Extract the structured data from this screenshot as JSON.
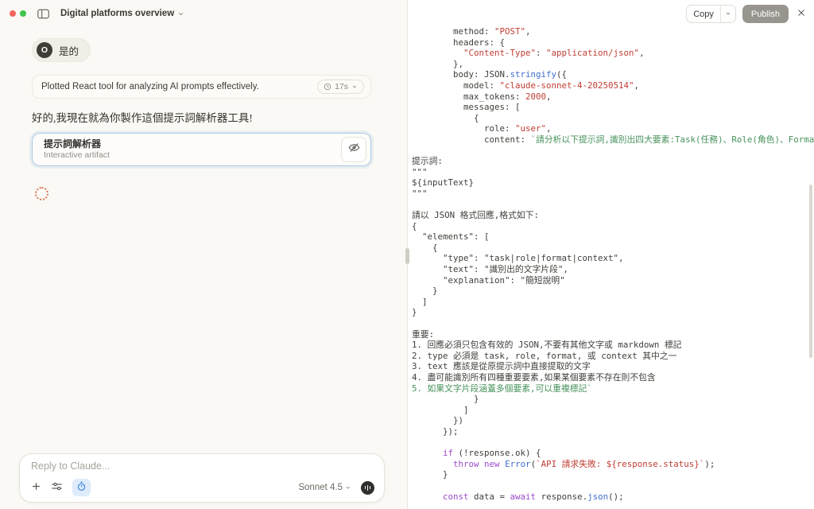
{
  "window": {
    "title": "Digital platforms overview"
  },
  "left_panel": {
    "user_message": {
      "avatar_initial": "O",
      "text": "是的"
    },
    "thinking": {
      "summary": "Plotted React tool for analyzing AI prompts effectively.",
      "duration": "17s"
    },
    "assistant_message": "好的,我現在就為你製作這個提示詞解析器工具!",
    "artifact_card": {
      "title": "提示詞解析器",
      "subtitle": "Interactive artifact"
    },
    "composer": {
      "placeholder": "Reply to Claude...",
      "model": "Sonnet 4.5"
    }
  },
  "right_panel": {
    "copy_button": "Copy",
    "publish_button": "Publish",
    "colors": {
      "plain": "#403f3a",
      "string": "#c03d33",
      "number": "#bf4136",
      "function": "#3e6fce",
      "keyword": "#9c4bc9",
      "template": "#47925b",
      "accent": "#d97757"
    },
    "code_lines": [
      [
        [
          "p",
          "        method: "
        ],
        [
          "s",
          "\"POST\""
        ],
        [
          "p",
          ","
        ]
      ],
      [
        [
          "p",
          "        headers: {"
        ]
      ],
      [
        [
          "p",
          "          "
        ],
        [
          "s",
          "\"Content-Type\""
        ],
        [
          "p",
          ": "
        ],
        [
          "s",
          "\"application/json\""
        ],
        [
          "p",
          ","
        ]
      ],
      [
        [
          "p",
          "        },"
        ]
      ],
      [
        [
          "p",
          "        body: JSON."
        ],
        [
          "f",
          "stringify"
        ],
        [
          "p",
          "({"
        ]
      ],
      [
        [
          "p",
          "          model: "
        ],
        [
          "s",
          "\"claude-sonnet-4-20250514\""
        ],
        [
          "p",
          ","
        ]
      ],
      [
        [
          "p",
          "          max_tokens: "
        ],
        [
          "n",
          "2000"
        ],
        [
          "p",
          ","
        ]
      ],
      [
        [
          "p",
          "          messages: ["
        ]
      ],
      [
        [
          "p",
          "            {"
        ]
      ],
      [
        [
          "p",
          "              role: "
        ],
        [
          "s",
          "\"user\""
        ],
        [
          "p",
          ","
        ]
      ],
      [
        [
          "p",
          "              content: "
        ],
        [
          "g",
          "`請分析以下提示詞,識別出四大要素:Task(任務)、Role(角色)、Format(格式)、Context(情境)"
        ]
      ],
      [],
      [
        [
          "p",
          "提示詞:"
        ]
      ],
      [
        [
          "p",
          "\"\"\""
        ]
      ],
      [
        [
          "p",
          "${inputText}"
        ]
      ],
      [
        [
          "p",
          "\"\"\""
        ]
      ],
      [],
      [
        [
          "p",
          "請以 JSON 格式回應,格式如下:"
        ]
      ],
      [
        [
          "p",
          "{"
        ]
      ],
      [
        [
          "p",
          "  \"elements\": ["
        ]
      ],
      [
        [
          "p",
          "    {"
        ]
      ],
      [
        [
          "p",
          "      \"type\": \"task|role|format|context\","
        ]
      ],
      [
        [
          "p",
          "      \"text\": \"識別出的文字片段\","
        ]
      ],
      [
        [
          "p",
          "      \"explanation\": \"簡短說明\""
        ]
      ],
      [
        [
          "p",
          "    }"
        ]
      ],
      [
        [
          "p",
          "  ]"
        ]
      ],
      [
        [
          "p",
          "}"
        ]
      ],
      [],
      [
        [
          "p",
          "重要:"
        ]
      ],
      [
        [
          "p",
          "1. 回應必須只包含有效的 JSON,不要有其他文字或 markdown 標記"
        ]
      ],
      [
        [
          "p",
          "2. type 必須是 task, role, format, 或 context 其中之一"
        ]
      ],
      [
        [
          "p",
          "3. text 應該是從原提示詞中直接提取的文字"
        ]
      ],
      [
        [
          "p",
          "4. 盡可能識別所有四種重要要素,如果某個要素不存在則不包含"
        ]
      ],
      [
        [
          "g",
          "5. 如果文字片段涵蓋多個要素,可以重複標記`"
        ]
      ],
      [
        [
          "p",
          "            }"
        ]
      ],
      [
        [
          "p",
          "          ]"
        ]
      ],
      [
        [
          "p",
          "        })"
        ]
      ],
      [
        [
          "p",
          "      });"
        ]
      ],
      [],
      [
        [
          "p",
          "      "
        ],
        [
          "k",
          "if"
        ],
        [
          "p",
          " (!response.ok) {"
        ]
      ],
      [
        [
          "p",
          "        "
        ],
        [
          "k",
          "throw"
        ],
        [
          "p",
          " "
        ],
        [
          "k",
          "new"
        ],
        [
          "p",
          " "
        ],
        [
          "f",
          "Error"
        ],
        [
          "p",
          "("
        ],
        [
          "s",
          "`API 請求失敗: ${response.status}`"
        ],
        [
          "p",
          ");"
        ]
      ],
      [
        [
          "p",
          "      }"
        ]
      ],
      [],
      [
        [
          "p",
          "      "
        ],
        [
          "k",
          "const"
        ],
        [
          "p",
          " data = "
        ],
        [
          "k",
          "await"
        ],
        [
          "p",
          " response."
        ],
        [
          "f",
          "json"
        ],
        [
          "p",
          "();"
        ]
      ]
    ]
  }
}
